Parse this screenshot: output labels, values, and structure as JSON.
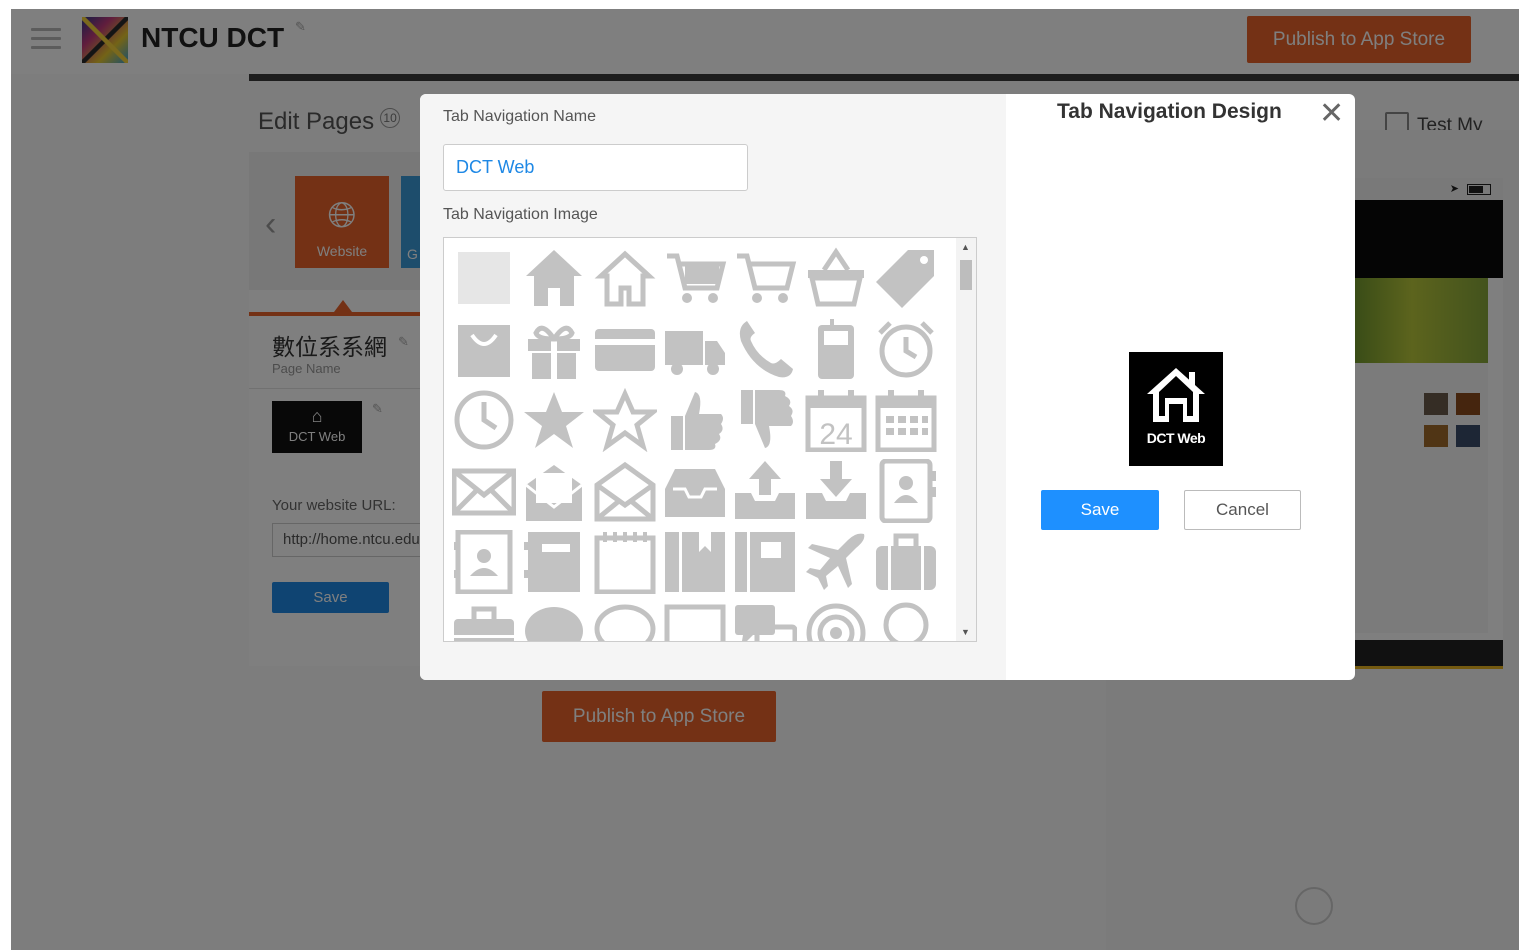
{
  "header": {
    "app_name": "NTCU DCT",
    "logo_text": "DCT",
    "publish_label": "Publish to App Store"
  },
  "editor": {
    "edit_pages_label": "Edit Pages",
    "page_count": "10",
    "test_app_label": "Test My App",
    "tiles": [
      {
        "label": "Website",
        "icon": "globe-icon"
      },
      {
        "label": "G",
        "icon": ""
      }
    ],
    "page_name_value": "數位系系網",
    "page_name_label": "Page Name",
    "tab_thumb_label": "DCT Web",
    "url_label": "Your website URL:",
    "url_value": "http://home.ntcu.edu",
    "save_label": "Save",
    "publish_label": "Publish to App Store"
  },
  "modal": {
    "name_label": "Tab Navigation Name",
    "name_value": "DCT Web",
    "image_label": "Tab Navigation Image",
    "design_title": "Tab Navigation Design",
    "close_icon": "close-icon",
    "preview_label": "DCT Web",
    "save_label": "Save",
    "cancel_label": "Cancel",
    "icons": [
      "blank-icon",
      "home-filled-icon",
      "home-outline-icon",
      "cart-filled-icon",
      "cart-outline-icon",
      "basket-icon",
      "tag-icon",
      "shopping-bag-icon",
      "gift-icon",
      "credit-card-icon",
      "truck-icon",
      "phone-icon",
      "mobile-phone-icon",
      "alarm-clock-icon",
      "clock-icon",
      "star-filled-icon",
      "star-outline-icon",
      "thumbs-up-icon",
      "thumbs-down-icon",
      "calendar-24-icon",
      "calendar-grid-icon",
      "mail-icon",
      "mail-open-icon",
      "mail-open-outline-icon",
      "inbox-icon",
      "inbox-upload-icon",
      "inbox-download-icon",
      "address-book-icon",
      "contact-book-icon",
      "notebook-icon",
      "notepad-icon",
      "book-icon",
      "bookmark-icon",
      "airplane-icon",
      "suitcase-icon",
      "briefcase-icon",
      "chat-bubble-filled-icon",
      "chat-bubble-outline-icon",
      "speech-square-icon",
      "chat-multi-icon",
      "target-icon",
      "lightbulb-icon"
    ],
    "calendar_day": "24"
  },
  "colors": {
    "accent_orange": "#e8632a",
    "accent_blue": "#1e90ff",
    "icon_gray": "#c2c2c2"
  }
}
